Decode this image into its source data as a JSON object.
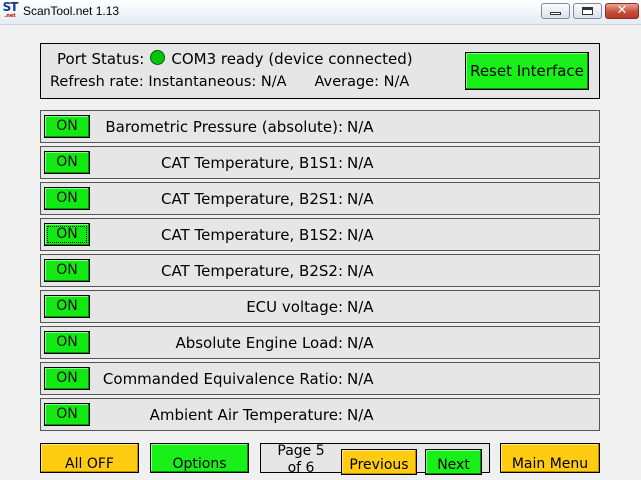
{
  "window": {
    "title": "ScanTool.net 1.13",
    "icon_text": "ST",
    "icon_subtext": ".net",
    "controls": {
      "minimize": "minimize-icon",
      "maximize": "maximize-icon",
      "close": "✕"
    }
  },
  "status": {
    "port_label": "Port Status:",
    "port_value": "COM3 ready (device connected)",
    "led_color": "#06c40b",
    "refresh_label": "Refresh rate: Instantaneous:",
    "refresh_instant": "N/A",
    "average_label": "Average:",
    "average_value": "N/A",
    "reset_label": "Reset Interface"
  },
  "sensors": [
    {
      "button": "ON",
      "label": "Barometric Pressure (absolute):",
      "value": "N/A"
    },
    {
      "button": "ON",
      "label": "CAT Temperature, B1S1:",
      "value": "N/A"
    },
    {
      "button": "ON",
      "label": "CAT Temperature, B2S1:",
      "value": "N/A"
    },
    {
      "button": "ON",
      "label": "CAT Temperature, B1S2:",
      "value": "N/A"
    },
    {
      "button": "ON",
      "label": "CAT Temperature, B2S2:",
      "value": "N/A"
    },
    {
      "button": "ON",
      "label": "ECU voltage:",
      "value": "N/A"
    },
    {
      "button": "ON",
      "label": "Absolute Engine Load:",
      "value": "N/A"
    },
    {
      "button": "ON",
      "label": "Commanded Equivalence Ratio:",
      "value": "N/A"
    },
    {
      "button": "ON",
      "label": "Ambient Air Temperature:",
      "value": "N/A"
    }
  ],
  "footer": {
    "all_off": "All OFF",
    "options": "Options",
    "page_label": "Page 5 of 6",
    "previous": "Previous",
    "next": "Next",
    "main_menu": "Main Menu"
  },
  "colors": {
    "on_button": "#12e812",
    "yellow_button": "#ffcc11",
    "panel_bg": "#e6e6e6"
  }
}
